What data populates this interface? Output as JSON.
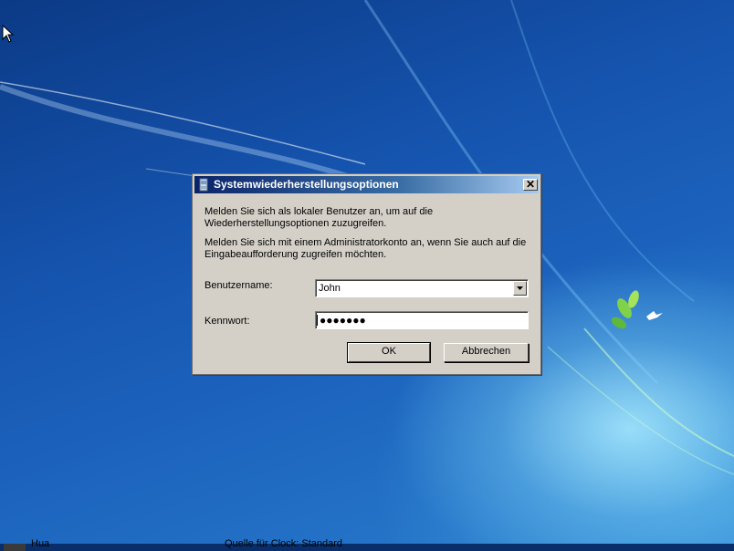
{
  "dialog": {
    "title": "Systemwiederherstellungsoptionen",
    "close_label": "✕",
    "message1": "Melden Sie sich als lokaler Benutzer an, um auf die Wiederherstellungsoptionen zuzugreifen.",
    "message2": "Melden Sie sich mit einem Administratorkonto  an, wenn Sie auch auf die Eingabeaufforderung zugreifen möchten.",
    "username_label": "Benutzername:",
    "username_value": "John",
    "password_label": "Kennwort:",
    "password_masked": "●●●●●●●",
    "ok_label": "OK",
    "cancel_label": "Abbrechen"
  },
  "taskbar_fragments": {
    "left_text": "Hua",
    "center_text": "Quelle für Clock:   Standard"
  },
  "colors": {
    "desktop_blue": "#1553ad",
    "titlebar_start": "#0a246a",
    "titlebar_end": "#a6caf0",
    "dialog_face": "#d4d0c8"
  },
  "icons": {
    "title_icon": "restore-app-icon",
    "combo_arrow": "chevron-down-icon",
    "cursor": "mouse-pointer-icon",
    "wallpaper_logo": "bird-and-leaves-icon"
  }
}
